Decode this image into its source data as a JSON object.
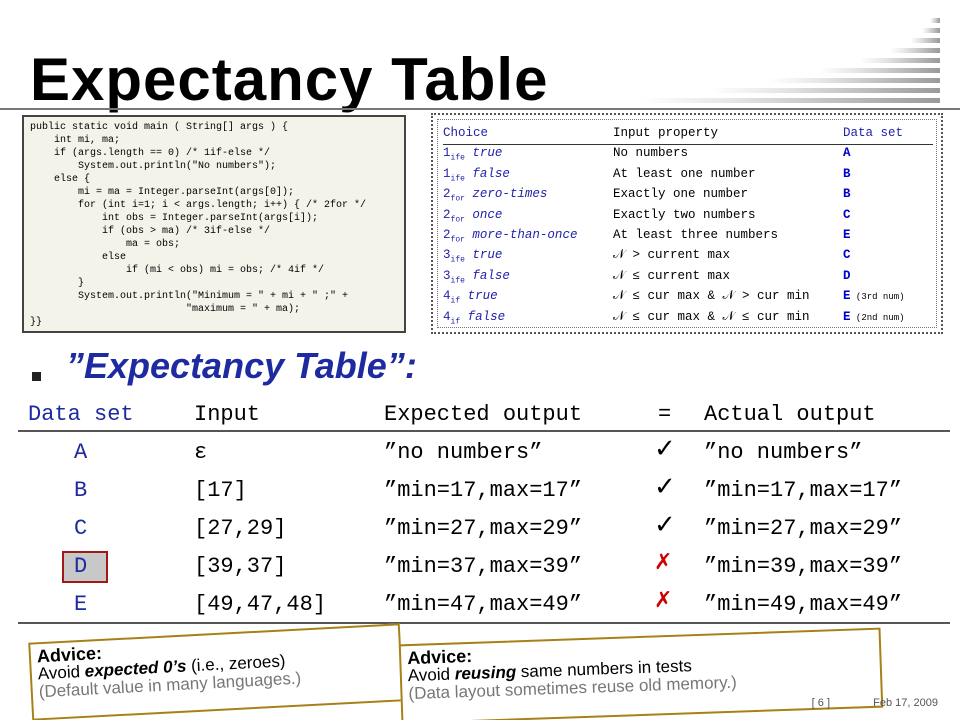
{
  "title": "Expectancy Table",
  "code": [
    "public static void main ( String[] args ) {",
    "    int mi, ma;",
    "    if (args.length == 0) /* 1if-else */",
    "        System.out.println(\"No numbers\");",
    "    else {",
    "        mi = ma = Integer.parseInt(args[0]);",
    "        for (int i=1; i < args.length; i++) { /* 2for */",
    "            int obs = Integer.parseInt(args[i]);",
    "            if (obs > ma) /* 3if-else */",
    "                ma = obs;",
    "            else",
    "                if (mi < obs) mi = obs; /* 4if */",
    "        }",
    "        System.out.println(\"Minimum = \" + mi + \" ;\" +",
    "                          \"maximum = \" + ma);",
    "}}"
  ],
  "choice_table": {
    "headers": [
      "Choice",
      "Input property",
      "Data set"
    ],
    "rows": [
      {
        "num": "1",
        "sub": "ife",
        "label": "true",
        "property": "No numbers",
        "dataset": "A",
        "note": ""
      },
      {
        "num": "1",
        "sub": "ife",
        "label": "false",
        "property": "At least one number",
        "dataset": "B",
        "note": ""
      },
      {
        "num": "2",
        "sub": "for",
        "label": "zero-times",
        "property": "Exactly one number",
        "dataset": "B",
        "note": ""
      },
      {
        "num": "2",
        "sub": "for",
        "label": "once",
        "property": "Exactly two numbers",
        "dataset": "C",
        "note": ""
      },
      {
        "num": "2",
        "sub": "for",
        "label": "more-than-once",
        "property": "At least three numbers",
        "dataset": "E",
        "note": ""
      },
      {
        "num": "3",
        "sub": "ife",
        "label": "true",
        "property": "𝒩 > current max",
        "dataset": "C",
        "note": ""
      },
      {
        "num": "3",
        "sub": "ife",
        "label": "false",
        "property": "𝒩 ≤ current max",
        "dataset": "D",
        "note": ""
      },
      {
        "num": "4",
        "sub": "if",
        "label": "true",
        "property": "𝒩 ≤ cur max & 𝒩 > cur min",
        "dataset": "E",
        "note": "(3rd num)"
      },
      {
        "num": "4",
        "sub": "if",
        "label": "false",
        "property": "𝒩 ≤ cur max & 𝒩 ≤ cur min",
        "dataset": "E",
        "note": "(2nd num)"
      }
    ]
  },
  "subtitle": "Expectancy Table",
  "expectancy": {
    "headers": [
      "Data set",
      "Input",
      "Expected output",
      "=",
      "Actual output"
    ],
    "rows": [
      {
        "dataset": "A",
        "input": "ε",
        "expected": "”no numbers”",
        "match": "check",
        "actual": "”no numbers”"
      },
      {
        "dataset": "B",
        "input": "[17]",
        "expected": "”min=17,max=17”",
        "match": "check",
        "actual": "”min=17,max=17”"
      },
      {
        "dataset": "C",
        "input": "[27,29]",
        "expected": "”min=27,max=29”",
        "match": "check",
        "actual": "”min=27,max=29”"
      },
      {
        "dataset": "D",
        "input": "[39,37]",
        "expected": "”min=37,max=39”",
        "match": "cross",
        "actual": "”min=39,max=39”"
      },
      {
        "dataset": "E",
        "input": "[49,47,48]",
        "expected": "”min=47,max=49”",
        "match": "cross",
        "actual": "”min=49,max=49”"
      }
    ]
  },
  "advice1": {
    "label": "Advice:",
    "pre": "Avoid ",
    "em": "expected 0’s",
    "post": " (i.e., zeroes)",
    "gray": "(Default value in many languages.)"
  },
  "advice2": {
    "label": "Advice:",
    "pre": "Avoid ",
    "em": "reusing",
    "post": " same numbers in tests",
    "gray": "(Data layout sometimes reuse old memory.)"
  },
  "footer": {
    "page": "[ 6 ]",
    "date": "Feb 17, 2009"
  },
  "colors": {
    "accent": "#1d2aa0",
    "cross": "#cc0000",
    "note_border": "#a88018",
    "code_bg": "#f4f3ea"
  }
}
